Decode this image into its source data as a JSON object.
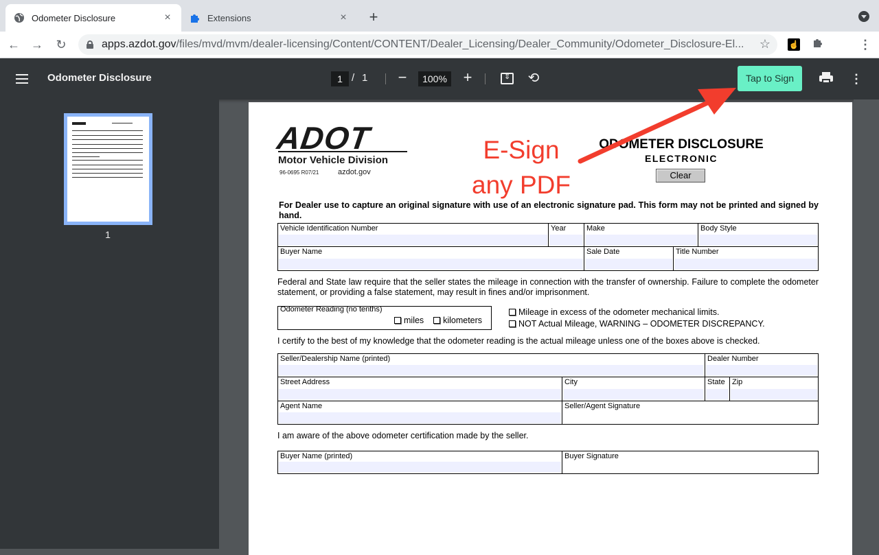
{
  "tabs": [
    {
      "title": "Odometer Disclosure",
      "icon": "globe-icon",
      "active": true
    },
    {
      "title": "Extensions",
      "icon": "puzzle-icon",
      "active": false
    }
  ],
  "address": {
    "host": "apps.azdot.gov",
    "path": "/files/mvd/mvm/dealer-licensing/Content/CONTENT/Dealer_Licensing/Dealer_Community/Odometer_Disclosure-El..."
  },
  "pdf_toolbar": {
    "title": "Odometer Disclosure",
    "page_current": "1",
    "page_sep": "/",
    "page_total": "1",
    "zoom": "100%",
    "sign_label": "Tap to Sign"
  },
  "sidebar": {
    "thumb_label": "1"
  },
  "document": {
    "logo": "ADOT",
    "division": "Motor Vehicle Division",
    "form_number": "96-0695  R07/21",
    "site": "azdot.gov",
    "overlay": {
      "line1": "E-Sign",
      "line2": "any PDF"
    },
    "title": "ODOMETER DISCLOSURE",
    "subtitle": "ELECTRONIC",
    "clear_label": "Clear",
    "intro": "For Dealer use to capture an original signature with use of an electronic signature pad. This form may not be printed and signed by hand.",
    "fields_row1": [
      "Vehicle Identification Number",
      "Year",
      "Make",
      "Body Style"
    ],
    "fields_row2": [
      "Buyer Name",
      "Sale Date",
      "Title Number"
    ],
    "law_text": "Federal and State law require that the seller states the mileage in connection with the transfer of ownership. Failure to complete the odometer statement, or providing a false statement, may result in fines and/or imprisonment.",
    "odometer_label": "Odometer Reading (no tenths)",
    "unit_miles": "miles",
    "unit_km": "kilometers",
    "mileage_opt1": "Mileage in excess of the odometer mechanical limits.",
    "mileage_opt2": "NOT Actual Mileage, WARNING – ODOMETER DISCREPANCY.",
    "certify_text": "I certify to the best of my knowledge that the odometer reading is the actual mileage unless one of the boxes above is checked.",
    "seller_fields": {
      "seller_name": "Seller/Dealership Name (printed)",
      "dealer_number": "Dealer Number",
      "street": "Street Address",
      "city": "City",
      "state": "State",
      "zip": "Zip",
      "agent_name": "Agent Name",
      "seller_sig": "Seller/Agent Signature"
    },
    "aware_text": "I am aware of the above odometer certification made by the seller.",
    "buyer_fields": {
      "buyer_name": "Buyer Name (printed)",
      "buyer_sig": "Buyer Signature"
    }
  },
  "colors": {
    "sign_button": "#69f0c6",
    "overlay_text": "#f23d2d",
    "field_fill": "#eef0ff"
  }
}
